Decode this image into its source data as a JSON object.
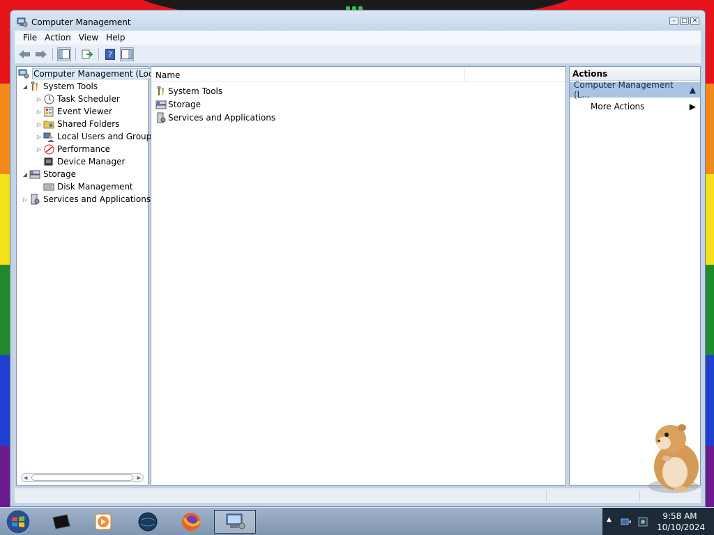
{
  "window": {
    "title": "Computer Management",
    "menus": [
      "File",
      "Action",
      "View",
      "Help"
    ]
  },
  "tree": {
    "items": [
      {
        "label": "Computer Management (Local",
        "level": 0
      },
      {
        "label": "System Tools",
        "level": 1
      },
      {
        "label": "Task Scheduler",
        "level": 2
      },
      {
        "label": "Event Viewer",
        "level": 2
      },
      {
        "label": "Shared Folders",
        "level": 2
      },
      {
        "label": "Local Users and Groups",
        "level": 2
      },
      {
        "label": "Performance",
        "level": 2
      },
      {
        "label": "Device Manager",
        "level": 2
      },
      {
        "label": "Storage",
        "level": 1
      },
      {
        "label": "Disk Management",
        "level": 2
      },
      {
        "label": "Services and Applications",
        "level": 1
      }
    ]
  },
  "main": {
    "column_name": "Name",
    "rows": [
      "System Tools",
      "Storage",
      "Services and Applications"
    ]
  },
  "actions": {
    "header": "Actions",
    "section": "Computer Management (L...",
    "more": "More Actions"
  },
  "taskbar": {
    "time": "9:58 AM",
    "date": "10/10/2024"
  }
}
